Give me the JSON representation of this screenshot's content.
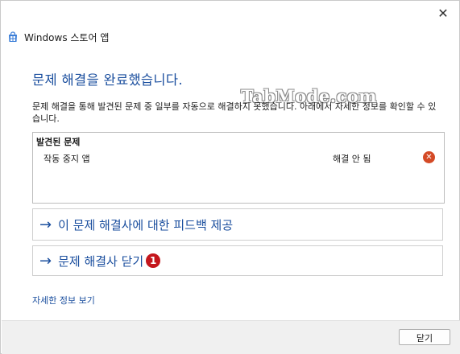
{
  "window": {
    "title": "Windows 스토어 앱",
    "close_glyph": "✕"
  },
  "heading": "문제 해결을 완료했습니다.",
  "description": "문제 해결을 통해 발견된 문제 중 일부를 자동으로 해결하지 못했습니다. 아래에서 자세한 정보를 확인할 수 있습니다.",
  "watermark": "TabMode.com",
  "issues": {
    "header": "발견된 문제",
    "rows": [
      {
        "name": "작동 중지 앱",
        "status": "해결 안 됨",
        "status_icon": "error-icon"
      }
    ]
  },
  "actions": [
    {
      "label": "이 문제 해결사에 대한 피드백 제공",
      "icon": "arrow-right-icon"
    },
    {
      "label": "문제 해결사 닫기",
      "icon": "arrow-right-icon",
      "badge": "1"
    }
  ],
  "details_link": "자세한 정보 보기",
  "footer": {
    "close_label": "닫기"
  },
  "colors": {
    "accent": "#1a4e9e",
    "error": "#d44a26",
    "badge": "#c4161c"
  }
}
